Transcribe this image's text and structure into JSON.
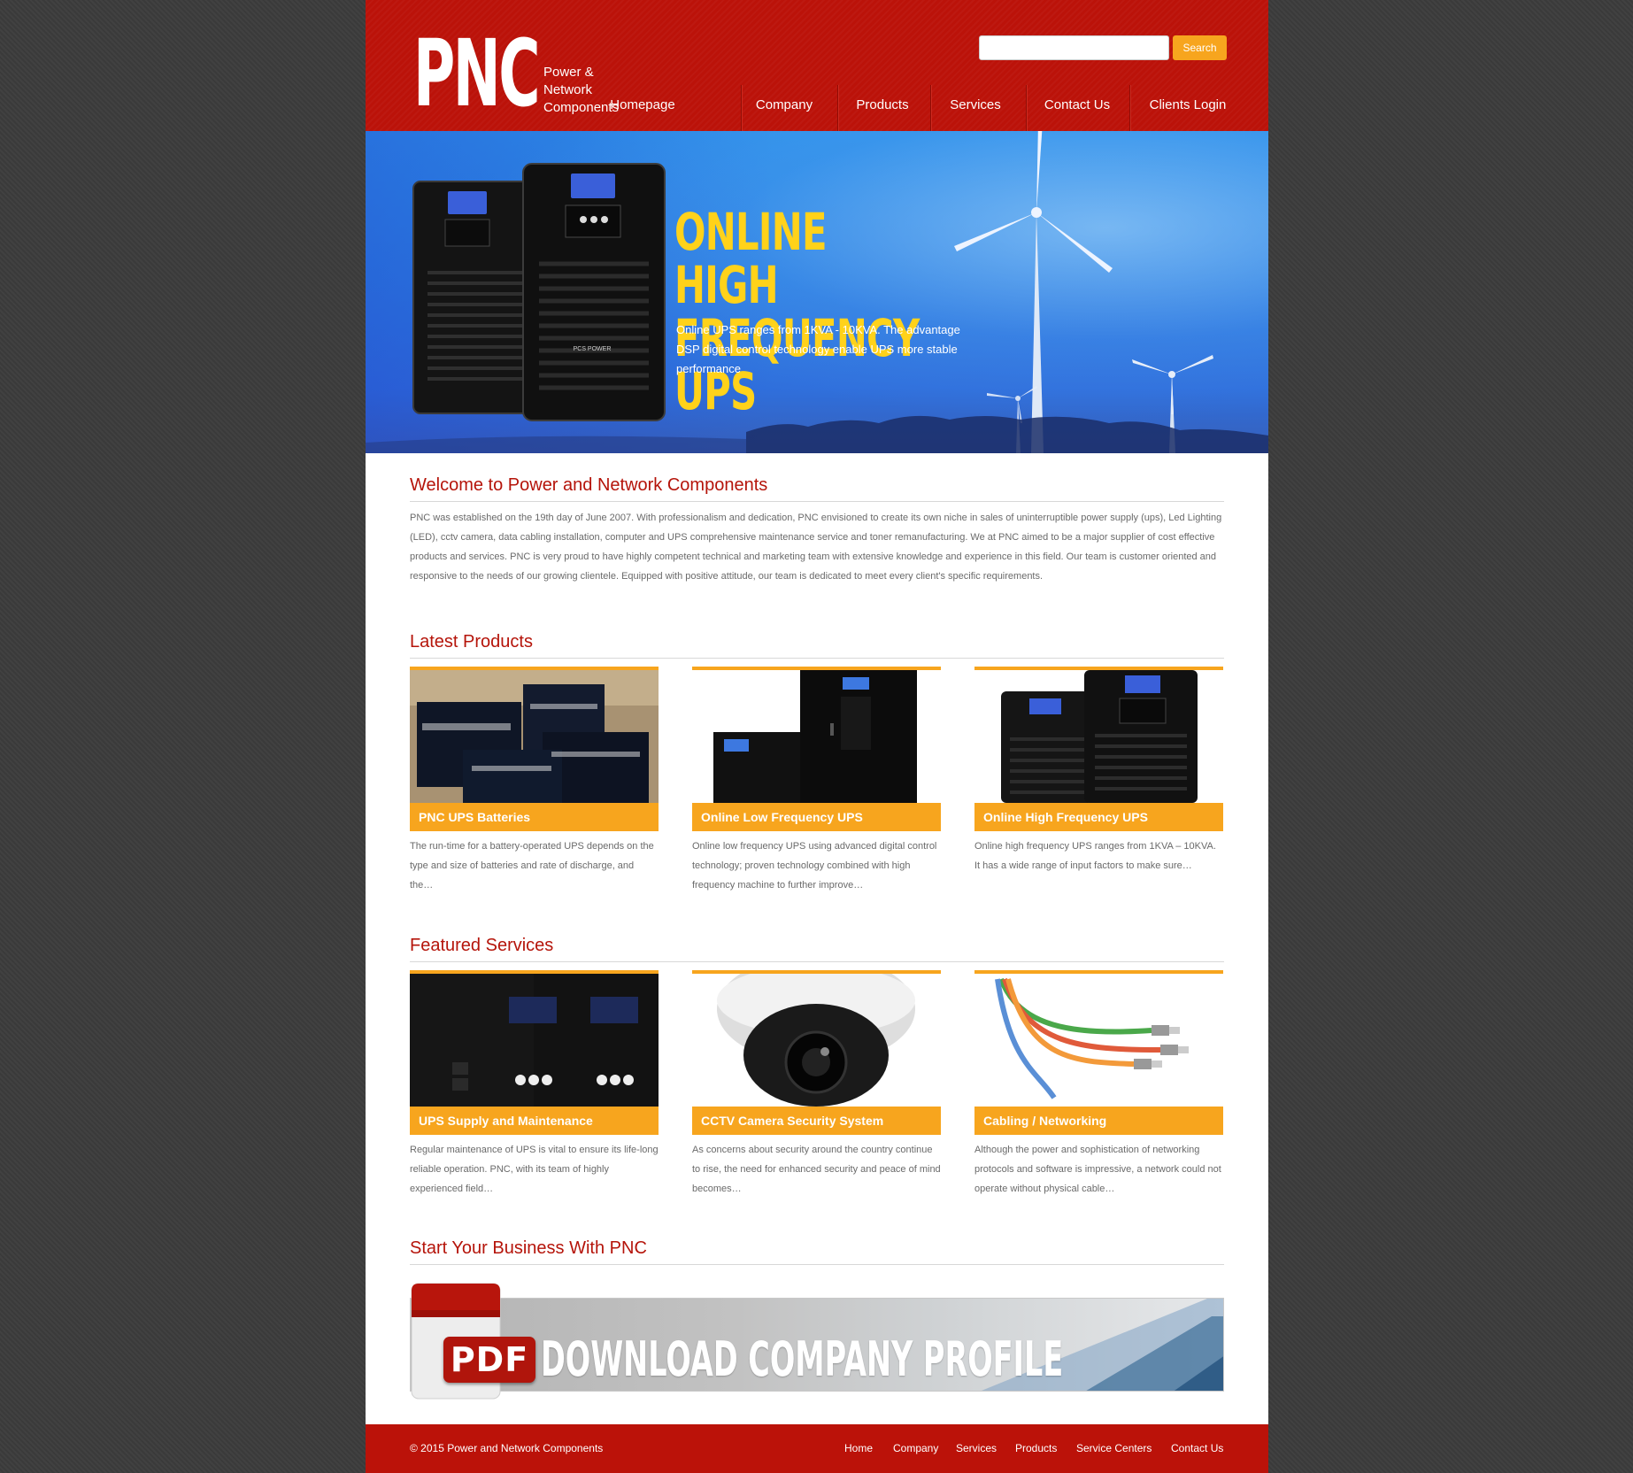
{
  "brand": {
    "logo": "PNC",
    "tagline": "Power &\nNetwork\nComponents",
    "red": "#bb1209",
    "orange": "#f7a51e",
    "yellow": "#ffd21a"
  },
  "search": {
    "value": "",
    "placeholder": "",
    "button": "Search"
  },
  "nav": [
    "Homepage",
    "Company",
    "Products",
    "Services",
    "Contact Us",
    "Clients Login"
  ],
  "banner": {
    "title": "Online High\nFrequency UPS",
    "text": "Online UPS ranges from 1KVA - 10KVA. The advantage DSP digital control technology enable UPS more stable performance",
    "product_label": "PCS POWER"
  },
  "welcome": {
    "title": "Welcome to Power and Network Components",
    "text": "PNC was established on the 19th day of June 2007. With professionalism and dedication, PNC envisioned to create its own niche in sales of uninterruptible power supply (ups), Led Lighting (LED), cctv camera, data cabling installation, computer and UPS comprehensive maintenance service and toner remanufacturing. We at PNC aimed to be a major supplier of cost effective products and services. PNC is very proud to have highly competent technical and marketing team with extensive knowledge and experience in this field. Our team is customer oriented and responsive to the needs of our growing clientele. Equipped with positive attitude, our team is dedicated to meet every client's specific requirements."
  },
  "products": {
    "title": "Latest Products",
    "items": [
      {
        "caption": "PNC UPS Batteries",
        "desc": "The run-time for a battery-operated UPS depends on the type and size of batteries and rate of discharge, and the…",
        "image": "ups-batteries-photo"
      },
      {
        "caption": "Online Low Frequency UPS",
        "desc": "Online low frequency UPS using advanced digital control technology;    proven technology combined with high frequency machine to further improve…",
        "image": "low-frequency-ups-photo"
      },
      {
        "caption": "Online High Frequency UPS",
        "desc": "Online high frequency UPS ranges from 1KVA – 10KVA. It has a wide range of input factors to make sure…",
        "image": "high-frequency-ups-photo"
      }
    ]
  },
  "services": {
    "title": "Featured Services",
    "items": [
      {
        "caption": "UPS Supply and Maintenance",
        "desc": "Regular maintenance of UPS is vital to ensure its life-long reliable operation. PNC, with its team of highly experienced field…",
        "image": "ups-panel-photo"
      },
      {
        "caption": "CCTV Camera Security System",
        "desc": "As concerns about security around the country continue to rise, the need for enhanced security and peace of mind becomes…",
        "image": "dome-camera-photo"
      },
      {
        "caption": "Cabling / Networking",
        "desc": "Although the power and sophistication of networking protocols and software is impressive, a network could not operate without physical cable…",
        "image": "network-cables-photo"
      }
    ]
  },
  "business": {
    "title": "Start Your Business With PNC",
    "pdf_label": "PDF",
    "cta": "Download Company Profile"
  },
  "footer": {
    "copyright": "© 2015 Power and Network Components",
    "links": [
      "Home",
      "Company",
      "Services",
      "Products",
      "Service Centers",
      "Contact Us"
    ]
  }
}
